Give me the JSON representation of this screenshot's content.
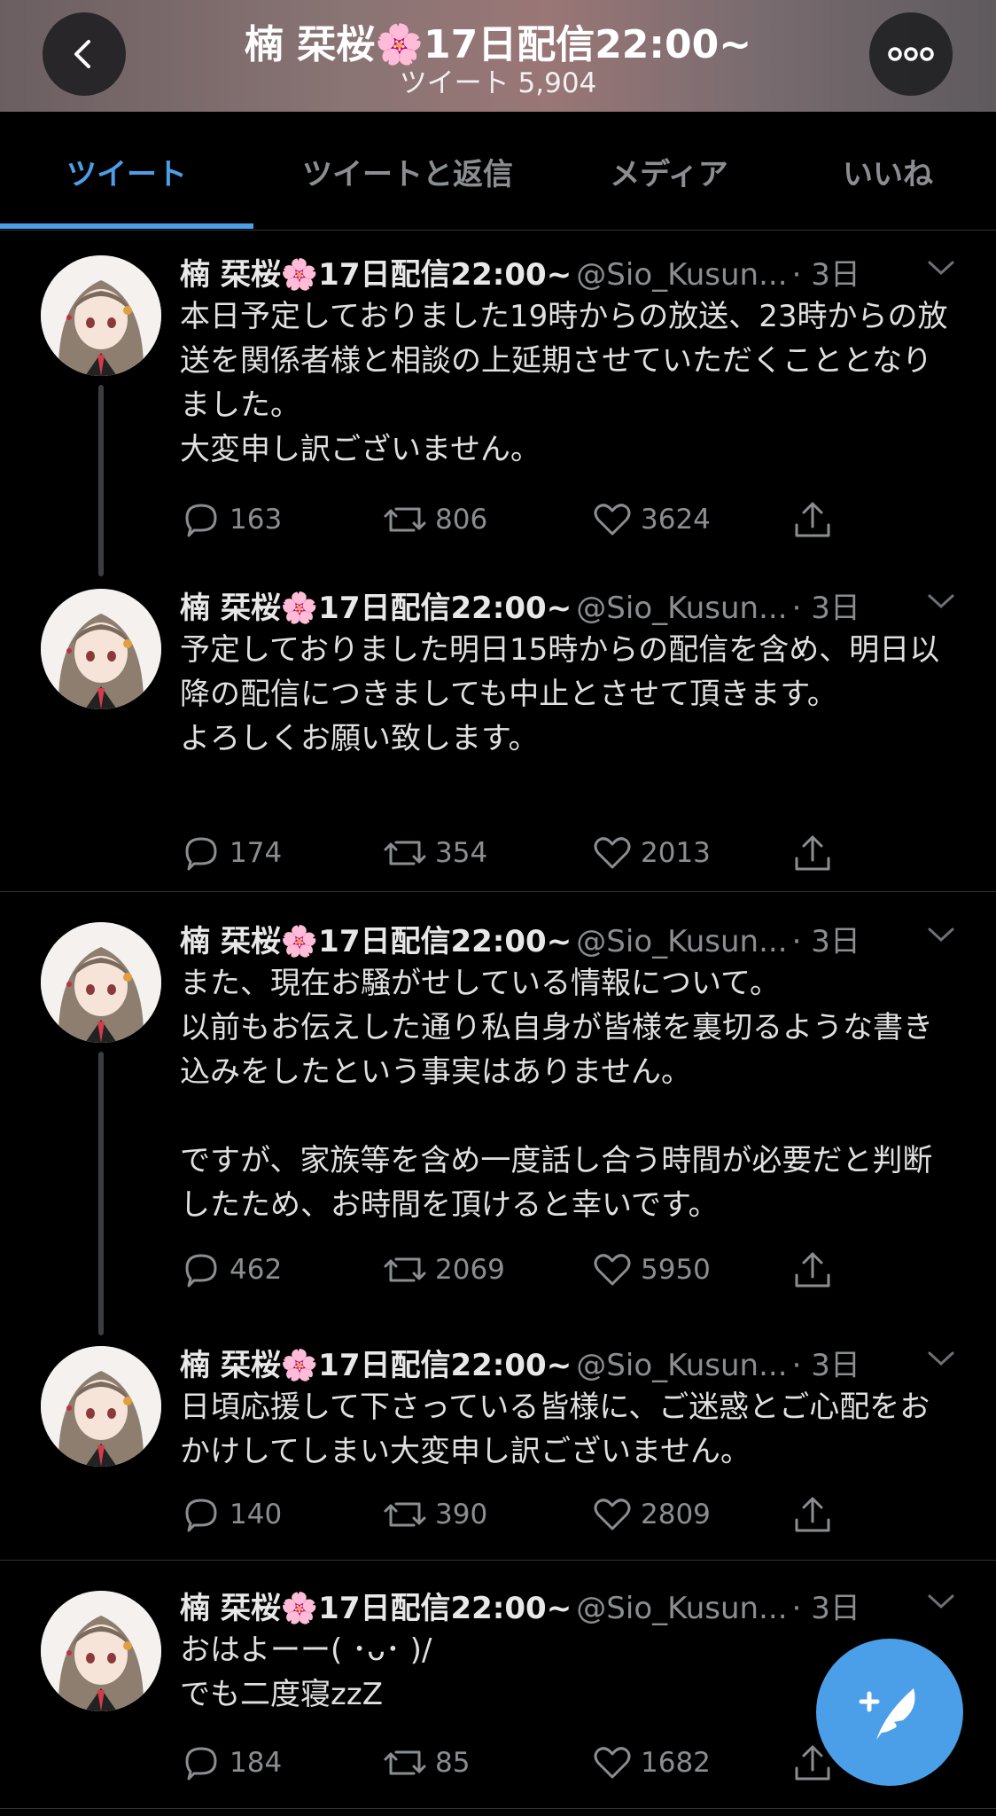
{
  "header": {
    "title": "楠 栞桜🌸17日配信22:00~",
    "tweet_count": "ツイート 5,904"
  },
  "tabs": [
    {
      "label": "ツイート",
      "active": true
    },
    {
      "label": "ツイートと返信",
      "active": false
    },
    {
      "label": "メディア",
      "active": false
    },
    {
      "label": "いいね",
      "active": false
    }
  ],
  "accent_color": "#4a9fe8",
  "tweets": [
    {
      "name": "楠 栞桜🌸17日配信22:00~",
      "handle": "@Sio_Kusun...",
      "time": "· 3日",
      "text": "本日予定しておりました19時からの放送、23時からの放送を関係者様と相談の上延期させていただくこととなりました。\n大変申し訳ございません。",
      "replies": "163",
      "retweets": "806",
      "likes": "3624"
    },
    {
      "name": "楠 栞桜🌸17日配信22:00~",
      "handle": "@Sio_Kusun...",
      "time": "· 3日",
      "text": "予定しておりました明日15時からの配信を含め、明日以降の配信につきましても中止とさせて頂きます。\nよろしくお願い致します。",
      "replies": "174",
      "retweets": "354",
      "likes": "2013"
    },
    {
      "name": "楠 栞桜🌸17日配信22:00~",
      "handle": "@Sio_Kusun...",
      "time": "· 3日",
      "text": "また、現在お騒がせしている情報について。\n以前もお伝えした通り私自身が皆様を裏切るような書き込みをしたという事実はありません。\n\nですが、家族等を含め一度話し合う時間が必要だと判断したため、お時間を頂けると幸いです。",
      "replies": "462",
      "retweets": "2069",
      "likes": "5950"
    },
    {
      "name": "楠 栞桜🌸17日配信22:00~",
      "handle": "@Sio_Kusun...",
      "time": "· 3日",
      "text": "日頃応援して下さっている皆様に、ご迷惑とご心配をおかけしてしまい大変申し訳ございません。",
      "replies": "140",
      "retweets": "390",
      "likes": "2809"
    },
    {
      "name": "楠 栞桜🌸17日配信22:00~",
      "handle": "@Sio_Kusun...",
      "time": "· 3日",
      "text": "おはよーー( ･ᴗ･ )/\nでも二度寝zzZ",
      "replies": "184",
      "retweets": "85",
      "likes": "1682"
    }
  ],
  "icons": {
    "back": "chevron-left-icon",
    "more": "more-horizontal-icon",
    "reply": "reply-bubble-icon",
    "retweet": "retweet-icon",
    "like": "heart-icon",
    "share": "share-icon",
    "compose": "compose-feather-icon"
  }
}
